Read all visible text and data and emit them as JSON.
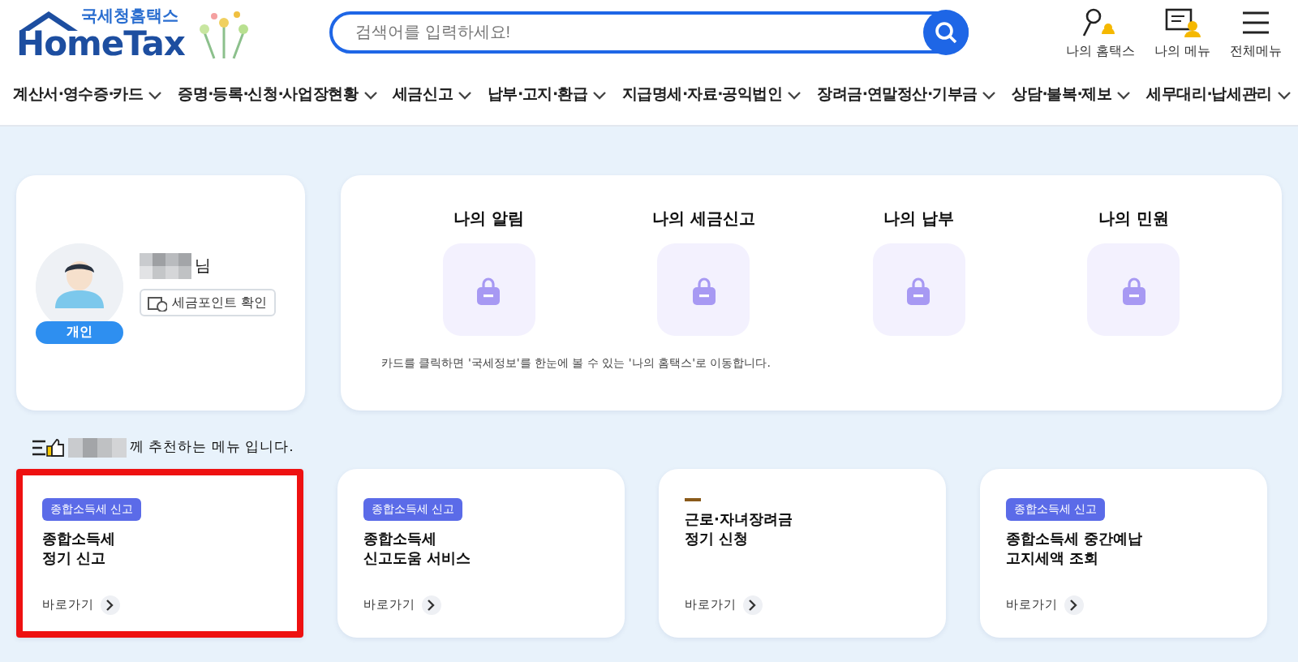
{
  "logo": {
    "subtitle": "국세청홈택스",
    "title": "HomeTax"
  },
  "search": {
    "placeholder": "검색어를 입력하세요!"
  },
  "header_links": [
    {
      "label": "나의 홈택스",
      "kind": "bell"
    },
    {
      "label": "나의 메뉴",
      "kind": "menu"
    },
    {
      "label": "전체메뉴",
      "kind": "hamburger"
    }
  ],
  "nav": [
    "계산서·영수증·카드",
    "증명·등록·신청·사업장현황",
    "세금신고",
    "납부·고지·환급",
    "지급명세·자료·공익법인",
    "장려금·연말정산·기부금",
    "상담·불복·제보",
    "세무대리·납세관리"
  ],
  "profile": {
    "suffix": "님",
    "type": "개인",
    "button": "세금포인트 확인"
  },
  "summary": {
    "items": [
      "나의 알림",
      "나의 세금신고",
      "나의 납부",
      "나의 민원"
    ],
    "note": "카드를 클릭하면 '국세정보'를 한눈에 볼 수 있는 '나의 홈택스'로 이동합니다."
  },
  "recommend": {
    "text": "께 추천하는 메뉴 입니다."
  },
  "cards": [
    {
      "kind": "tag",
      "tag": "종합소득세 신고",
      "title": "종합소득세\n정기 신고",
      "link": "바로가기",
      "highlighted": true
    },
    {
      "kind": "tag",
      "tag": "종합소득세 신고",
      "title": "종합소득세\n신고도움 서비스",
      "link": "바로가기",
      "highlighted": false
    },
    {
      "kind": "dash",
      "title": "근로·자녀장려금\n정기 신청",
      "link": "바로가기",
      "highlighted": false
    },
    {
      "kind": "tag",
      "tag": "종합소득세 신고",
      "title": "종합소득세 중간예납\n고지세액 조회",
      "link": "바로가기",
      "highlighted": false
    }
  ]
}
